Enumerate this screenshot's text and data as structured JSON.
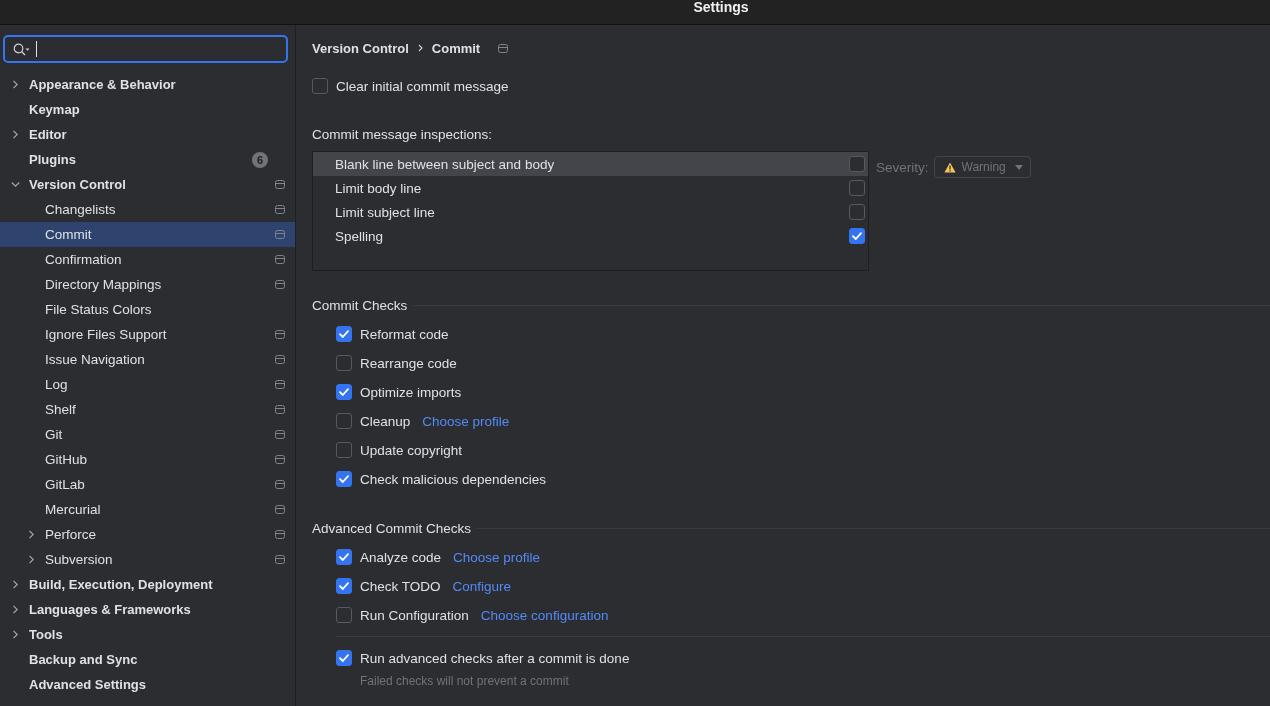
{
  "window": {
    "title": "Settings"
  },
  "sidebar": {
    "search": {
      "focused": true
    },
    "items": [
      {
        "label": "Appearance & Behavior",
        "expandable": true,
        "expanded": false,
        "selected": false,
        "project_scoped": false
      },
      {
        "label": "Keymap",
        "expandable": false,
        "expanded": false,
        "selected": false,
        "project_scoped": false
      },
      {
        "label": "Editor",
        "expandable": true,
        "expanded": false,
        "selected": false,
        "project_scoped": false
      },
      {
        "label": "Plugins",
        "expandable": false,
        "expanded": false,
        "selected": false,
        "project_scoped": false,
        "badge": "6"
      },
      {
        "label": "Version Control",
        "expandable": true,
        "expanded": true,
        "selected": false,
        "project_scoped": true,
        "children": [
          {
            "label": "Changelists",
            "expandable": false,
            "expanded": false,
            "selected": false,
            "project_scoped": true
          },
          {
            "label": "Commit",
            "expandable": false,
            "expanded": false,
            "selected": true,
            "project_scoped": true
          },
          {
            "label": "Confirmation",
            "expandable": false,
            "expanded": false,
            "selected": false,
            "project_scoped": true
          },
          {
            "label": "Directory Mappings",
            "expandable": false,
            "expanded": false,
            "selected": false,
            "project_scoped": true
          },
          {
            "label": "File Status Colors",
            "expandable": false,
            "expanded": false,
            "selected": false,
            "project_scoped": false
          },
          {
            "label": "Ignore Files Support",
            "expandable": false,
            "expanded": false,
            "selected": false,
            "project_scoped": true
          },
          {
            "label": "Issue Navigation",
            "expandable": false,
            "expanded": false,
            "selected": false,
            "project_scoped": true
          },
          {
            "label": "Log",
            "expandable": false,
            "expanded": false,
            "selected": false,
            "project_scoped": true
          },
          {
            "label": "Shelf",
            "expandable": false,
            "expanded": false,
            "selected": false,
            "project_scoped": true
          },
          {
            "label": "Git",
            "expandable": false,
            "expanded": false,
            "selected": false,
            "project_scoped": true
          },
          {
            "label": "GitHub",
            "expandable": false,
            "expanded": false,
            "selected": false,
            "project_scoped": true
          },
          {
            "label": "GitLab",
            "expandable": false,
            "expanded": false,
            "selected": false,
            "project_scoped": true
          },
          {
            "label": "Mercurial",
            "expandable": false,
            "expanded": false,
            "selected": false,
            "project_scoped": true
          },
          {
            "label": "Perforce",
            "expandable": true,
            "expanded": false,
            "selected": false,
            "project_scoped": true
          },
          {
            "label": "Subversion",
            "expandable": true,
            "expanded": false,
            "selected": false,
            "project_scoped": true
          }
        ]
      },
      {
        "label": "Build, Execution, Deployment",
        "expandable": true,
        "expanded": false,
        "selected": false,
        "project_scoped": false
      },
      {
        "label": "Languages & Frameworks",
        "expandable": true,
        "expanded": false,
        "selected": false,
        "project_scoped": false
      },
      {
        "label": "Tools",
        "expandable": true,
        "expanded": false,
        "selected": false,
        "project_scoped": false
      },
      {
        "label": "Backup and Sync",
        "expandable": false,
        "expanded": false,
        "selected": false,
        "project_scoped": false
      },
      {
        "label": "Advanced Settings",
        "expandable": false,
        "expanded": false,
        "selected": false,
        "project_scoped": false
      }
    ]
  },
  "page": {
    "breadcrumb": [
      {
        "label": "Version Control"
      },
      {
        "label": "Commit"
      }
    ],
    "project_scoped": true,
    "clear_initial_message": {
      "label": "Clear initial commit message",
      "checked": false
    },
    "inspections": {
      "label": "Commit message inspections:",
      "rows": [
        {
          "label": "Blank line between subject and body",
          "checked": false,
          "selected": true
        },
        {
          "label": "Limit body line",
          "checked": false,
          "selected": false
        },
        {
          "label": "Limit subject line",
          "checked": false,
          "selected": false
        },
        {
          "label": "Spelling",
          "checked": true,
          "selected": false
        }
      ],
      "severity": {
        "label": "Severity:",
        "value": "Warning",
        "disabled": true
      }
    },
    "sections": [
      {
        "title": "Commit Checks",
        "options": [
          {
            "label": "Reformat code",
            "checked": true
          },
          {
            "label": "Rearrange code",
            "checked": false
          },
          {
            "label": "Optimize imports",
            "checked": true
          },
          {
            "label": "Cleanup",
            "checked": false,
            "link": "Choose profile"
          },
          {
            "label": "Update copyright",
            "checked": false
          },
          {
            "label": "Check malicious dependencies",
            "checked": true
          }
        ]
      },
      {
        "title": "Advanced Commit Checks",
        "options": [
          {
            "label": "Analyze code",
            "checked": true,
            "link": "Choose profile"
          },
          {
            "label": "Check TODO",
            "checked": true,
            "link": "Configure"
          },
          {
            "label": "Run Configuration",
            "checked": false,
            "link": "Choose configuration"
          }
        ],
        "footer": {
          "label": "Run advanced checks after a commit is done",
          "checked": true,
          "hint": "Failed checks will not prevent a commit"
        }
      }
    ]
  }
}
